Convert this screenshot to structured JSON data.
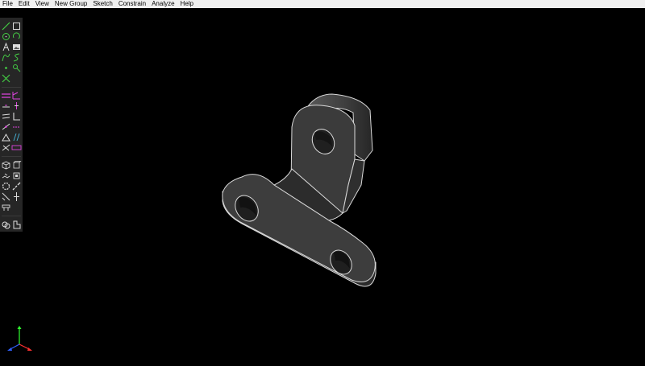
{
  "menu": [
    "File",
    "Edit",
    "View",
    "New Group",
    "Sketch",
    "Constrain",
    "Analyze",
    "Help"
  ],
  "toolbar": {
    "groups": [
      [
        "line-icon",
        "rectangle-icon",
        "circle-icon",
        "arc-icon",
        "text-icon",
        "image-icon",
        "cubic-spline-icon",
        "tangent-arc-icon",
        "point-icon",
        "split-curves-icon",
        "construction-icon"
      ],
      [
        "distance-constraint-icon",
        "angle-constraint-icon",
        "horizontal-constraint-icon",
        "vertical-constraint-icon",
        "parallel-constraint-icon",
        "perpendicular-constraint-icon",
        "point-on-line-constraint-icon",
        "symmetric-constraint-icon",
        "equal-constraint-icon",
        "same-orientation-icon",
        "other-supplementary-angle-icon",
        "reference-dimension-icon"
      ],
      [
        "nearest-isometric-view-icon",
        "nearest-ortho-view-icon",
        "step-translating-icon",
        "step-rotating-icon",
        "extrude-icon",
        "helix-icon",
        "lathe-icon",
        "revolve-icon",
        "workplane-icon"
      ],
      [
        "link-file-icon",
        "import-icon"
      ]
    ]
  },
  "colors": {
    "background": "#000000",
    "sketch_tool_green": "#44cc44",
    "constraint_magenta": "#dd44dd",
    "axis_x": "#ff3030",
    "axis_y": "#30ff30",
    "axis_z": "#3060ff"
  }
}
